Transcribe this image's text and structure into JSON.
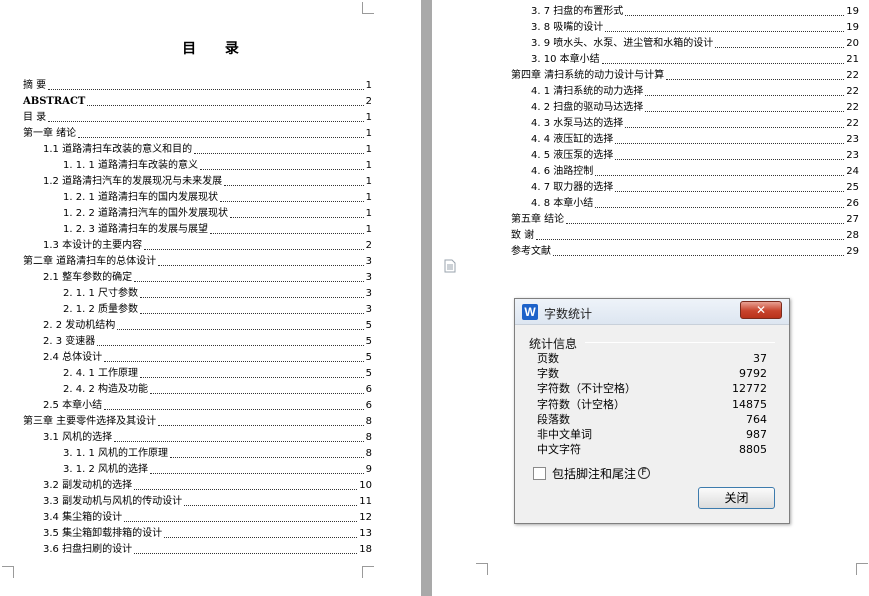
{
  "left_page": {
    "title": "目 录",
    "entries": [
      {
        "text": "摘      要",
        "page": "1",
        "indent": 0,
        "bold": false
      },
      {
        "text": "ABSTRACT",
        "page": "2",
        "indent": 0,
        "bold": true
      },
      {
        "text": "目    录",
        "page": "1",
        "indent": 0,
        "bold": false
      },
      {
        "text": "第一章  绪论",
        "page": "1",
        "indent": 0,
        "bold": false
      },
      {
        "text": "1.1 道路清扫车改装的意义和目的",
        "page": "1",
        "indent": 1,
        "bold": false
      },
      {
        "text": "1. 1. 1 道路清扫车改装的意义",
        "page": "1",
        "indent": 2,
        "bold": false
      },
      {
        "text": "1.2 道路清扫汽车的发展现况与未来发展",
        "page": "1",
        "indent": 1,
        "bold": false
      },
      {
        "text": "1. 2. 1 道路清扫车的国内发展现状",
        "page": "1",
        "indent": 2,
        "bold": false
      },
      {
        "text": "1. 2. 2 道路清扫汽车的国外发展现状",
        "page": "1",
        "indent": 2,
        "bold": false
      },
      {
        "text": "1. 2. 3  道路清扫车的发展与展望",
        "page": "1",
        "indent": 2,
        "bold": false
      },
      {
        "text": "1.3 本设计的主要内容",
        "page": "2",
        "indent": 1,
        "bold": false
      },
      {
        "text": "第二章  道路清扫车的总体设计",
        "page": "3",
        "indent": 0,
        "bold": false
      },
      {
        "text": "2.1 整车参数的确定",
        "page": "3",
        "indent": 1,
        "bold": false
      },
      {
        "text": "2. 1. 1 尺寸参数",
        "page": "3",
        "indent": 2,
        "bold": false
      },
      {
        "text": "2. 1. 2 质量参数",
        "page": "3",
        "indent": 2,
        "bold": false
      },
      {
        "text": "2. 2 发动机结构",
        "page": "5",
        "indent": 1,
        "bold": false
      },
      {
        "text": "2. 3  变速器",
        "page": "5",
        "indent": 1,
        "bold": false
      },
      {
        "text": "2.4 总体设计",
        "page": "5",
        "indent": 1,
        "bold": false
      },
      {
        "text": "2. 4. 1 工作原理",
        "page": "5",
        "indent": 2,
        "bold": false
      },
      {
        "text": "2. 4. 2 构造及功能",
        "page": "6",
        "indent": 2,
        "bold": false
      },
      {
        "text": "2.5 本章小结",
        "page": "6",
        "indent": 1,
        "bold": false
      },
      {
        "text": "第三章  主要零件选择及其设计",
        "page": "8",
        "indent": 0,
        "bold": false
      },
      {
        "text": "3.1 风机的选择",
        "page": "8",
        "indent": 1,
        "bold": false
      },
      {
        "text": "3. 1. 1 风机的工作原理",
        "page": "8",
        "indent": 2,
        "bold": false
      },
      {
        "text": "3. 1. 2 风机的选择",
        "page": "9",
        "indent": 2,
        "bold": false
      },
      {
        "text": "3.2 副发动机的选择",
        "page": "10",
        "indent": 1,
        "bold": false
      },
      {
        "text": "3.3 副发动机与风机的传动设计",
        "page": "11",
        "indent": 1,
        "bold": false
      },
      {
        "text": "3.4 集尘箱的设计",
        "page": "12",
        "indent": 1,
        "bold": false
      },
      {
        "text": "3.5 集尘箱卸载排箱的设计",
        "page": "13",
        "indent": 1,
        "bold": false
      },
      {
        "text": "3.6 扫盘扫刷的设计",
        "page": "18",
        "indent": 1,
        "bold": false
      }
    ]
  },
  "right_page": {
    "entries": [
      {
        "text": "3. 7 扫盘的布置形式",
        "page": "19",
        "indent": 1
      },
      {
        "text": "3. 8 吸嘴的设计",
        "page": "19",
        "indent": 1
      },
      {
        "text": "3. 9 喷水头、水泵、进尘管和水箱的设计",
        "page": "20",
        "indent": 1
      },
      {
        "text": "3. 10 本章小结",
        "page": "21",
        "indent": 1
      },
      {
        "text": "第四章  清扫系统的动力设计与计算",
        "page": "22",
        "indent": 0
      },
      {
        "text": "4. 1 清扫系统的动力选择",
        "page": "22",
        "indent": 1
      },
      {
        "text": "4. 2 扫盘的驱动马达选择",
        "page": "22",
        "indent": 1
      },
      {
        "text": "4. 3 水泵马达的选择",
        "page": "22",
        "indent": 1
      },
      {
        "text": "4. 4 液压缸的选择",
        "page": "23",
        "indent": 1
      },
      {
        "text": "4. 5 液压泵的选择",
        "page": "23",
        "indent": 1
      },
      {
        "text": "4. 6 油路控制",
        "page": "24",
        "indent": 1
      },
      {
        "text": "4. 7 取力器的选择",
        "page": "25",
        "indent": 1
      },
      {
        "text": "4. 8 本章小结",
        "page": "26",
        "indent": 1
      },
      {
        "text": "第五章  结论",
        "page": "27",
        "indent": 0
      },
      {
        "text": "致      谢",
        "page": "28",
        "indent": 0
      },
      {
        "text": "参考文献",
        "page": "29",
        "indent": 0
      }
    ]
  },
  "dialog": {
    "app_icon": "W",
    "title": "字数统计",
    "close_label": "✕",
    "section": "统计信息",
    "stats": [
      {
        "label": "页数",
        "value": "37"
      },
      {
        "label": "字数",
        "value": "9792"
      },
      {
        "label": "字符数（不计空格）",
        "value": "12772"
      },
      {
        "label": "字符数（计空格）",
        "value": "14875"
      },
      {
        "label": "段落数",
        "value": "764"
      },
      {
        "label": "非中文单词",
        "value": "987"
      },
      {
        "label": "中文字符",
        "value": "8805"
      }
    ],
    "checkbox_label": "包括脚注和尾注",
    "checkbox_key": "F",
    "checkbox_checked": false,
    "close_button_label": "关闭"
  }
}
